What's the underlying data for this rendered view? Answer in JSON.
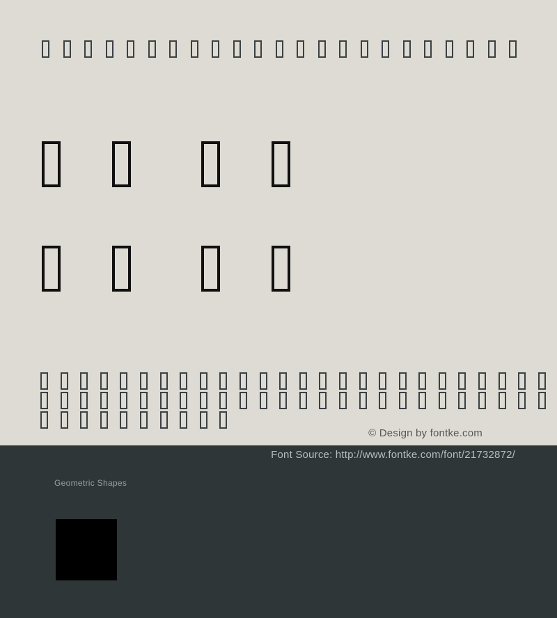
{
  "page": {
    "title": "Geometric Shapes Font Specimen",
    "background_light": "#dddbd3",
    "background_dark": "#2e3638",
    "glyph_outline_color": "#3a4042",
    "sample_glyph_color": "#000000"
  },
  "header_row": {
    "name": "header-glyph-strip",
    "glyph_count": 23,
    "glyph_type": "missing-glyph-box",
    "description": "Row of notdef / tofu boxes rendered across the top of the specimen"
  },
  "large_rows": [
    {
      "name": "large-glyph-row-1",
      "glyph_count": 4,
      "glyph_type": "missing-glyph-box",
      "has_gap_after_index": 2
    },
    {
      "name": "large-glyph-row-2",
      "glyph_count": 4,
      "glyph_type": "missing-glyph-box",
      "has_gap_after_index": 2
    }
  ],
  "grid_rows": [
    {
      "name": "grid-glyph-row-1",
      "glyph_count": 26,
      "glyph_type": "missing-glyph-box"
    },
    {
      "name": "grid-glyph-row-2",
      "glyph_count": 26,
      "glyph_type": "missing-glyph-box"
    },
    {
      "name": "grid-glyph-row-3",
      "glyph_count": 10,
      "glyph_type": "missing-glyph-box"
    }
  ],
  "credits": {
    "design": "© Design by fontke.com",
    "source": "Font Source: http://www.fontke.com/font/21732872/"
  },
  "block": {
    "label": "Geometric Shapes",
    "sample_glyph_name": "black-square-glyph"
  }
}
